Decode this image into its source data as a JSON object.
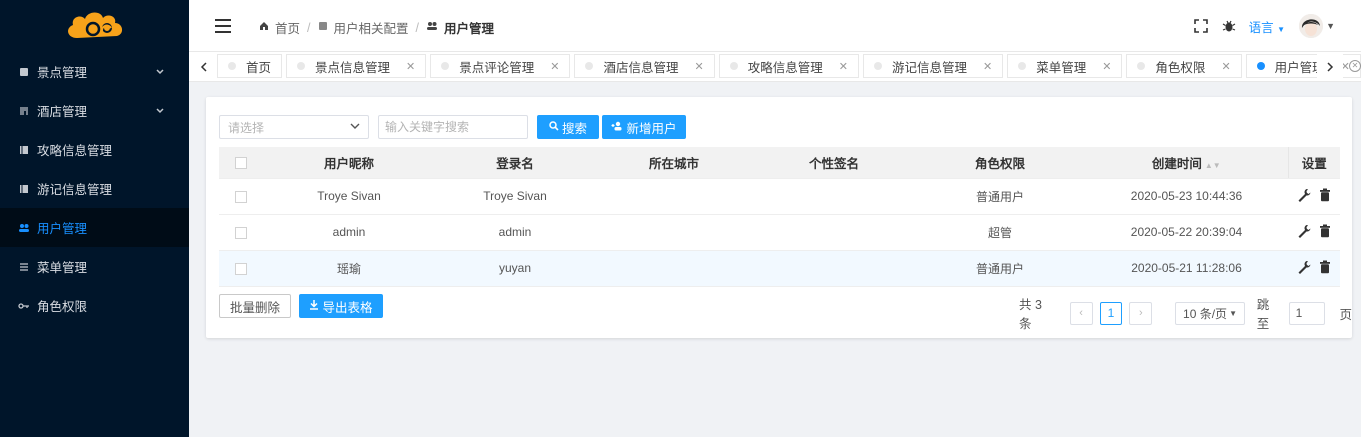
{
  "sidebar": {
    "items": [
      {
        "label": "景点管理",
        "icon": "square-icon",
        "has_children": true
      },
      {
        "label": "酒店管理",
        "icon": "cutlery-icon",
        "has_children": true
      },
      {
        "label": "攻略信息管理",
        "icon": "book-icon",
        "has_children": false
      },
      {
        "label": "游记信息管理",
        "icon": "book-icon",
        "has_children": false
      },
      {
        "label": "用户管理",
        "icon": "users-icon",
        "has_children": false,
        "active": true
      },
      {
        "label": "菜单管理",
        "icon": "menu-icon",
        "has_children": false
      },
      {
        "label": "角色权限",
        "icon": "key-icon",
        "has_children": false
      }
    ]
  },
  "header": {
    "breadcrumb": [
      "首页",
      "用户相关配置",
      "用户管理"
    ],
    "lang_label": "语言"
  },
  "tabs": [
    {
      "label": "首页",
      "closable": false
    },
    {
      "label": "景点信息管理",
      "closable": true
    },
    {
      "label": "景点评论管理",
      "closable": true
    },
    {
      "label": "酒店信息管理",
      "closable": true
    },
    {
      "label": "攻略信息管理",
      "closable": true
    },
    {
      "label": "游记信息管理",
      "closable": true
    },
    {
      "label": "菜单管理",
      "closable": true
    },
    {
      "label": "角色权限",
      "closable": true
    },
    {
      "label": "用户管理",
      "closable": true,
      "active": true
    }
  ],
  "toolbar": {
    "select_placeholder": "请选择",
    "search_placeholder": "输入关键字搜索",
    "search_label": "搜索",
    "add_label": "新增用户"
  },
  "table": {
    "columns": [
      "用户昵称",
      "登录名",
      "所在城市",
      "个性签名",
      "角色权限",
      "创建时间",
      "设置"
    ],
    "rows": [
      {
        "nickname": "Troye Sivan",
        "login": "Troye Sivan",
        "city": "",
        "signature": "",
        "role": "普通用户",
        "created": "2020-05-23 10:44:36"
      },
      {
        "nickname": "admin",
        "login": "admin",
        "city": "",
        "signature": "",
        "role": "超管",
        "created": "2020-05-22 20:39:04"
      },
      {
        "nickname": "瑶瑜",
        "login": "yuyan",
        "city": "",
        "signature": "",
        "role": "普通用户",
        "created": "2020-05-21 11:28:06"
      }
    ]
  },
  "footer": {
    "batch_delete_label": "批量删除",
    "export_label": "导出表格",
    "total_label": "共 3 条",
    "current_page": "1",
    "page_size_label": "10 条/页",
    "jump_label": "跳至",
    "jump_value": "1",
    "page_unit": "页"
  },
  "colors": {
    "sidebar_bg": "#00152a",
    "accent": "#1890ff",
    "button": "#1e9fff"
  }
}
